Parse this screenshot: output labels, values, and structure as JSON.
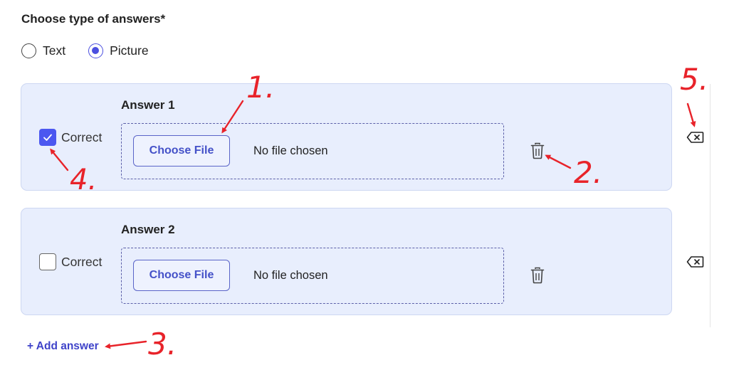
{
  "form": {
    "answer_type_label": "Choose type of answers*",
    "answer_type_options": [
      {
        "label": "Text",
        "selected": false
      },
      {
        "label": "Picture",
        "selected": true
      }
    ],
    "accent_color": "#4b57f0"
  },
  "answers": [
    {
      "title": "Answer 1",
      "correct_label": "Correct",
      "correct_checked": true,
      "choose_file_label": "Choose File",
      "file_status": "No file chosen"
    },
    {
      "title": "Answer 2",
      "correct_label": "Correct",
      "correct_checked": false,
      "choose_file_label": "Choose File",
      "file_status": "No file chosen"
    }
  ],
  "add_answer_label": "+ Add answer",
  "annotations": {
    "color": "#e8232a",
    "labels": [
      "1.",
      "2.",
      "3.",
      "4.",
      "5."
    ]
  },
  "icons": {
    "trash": "trash-icon",
    "delete_answer": "backspace-icon",
    "check": "check-icon"
  }
}
